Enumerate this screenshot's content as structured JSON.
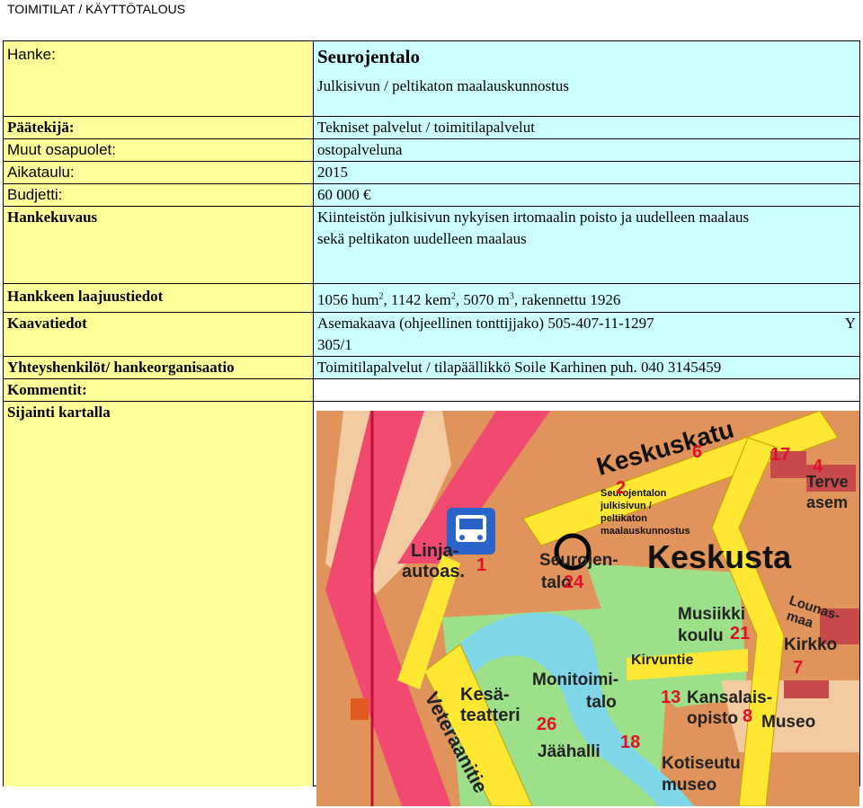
{
  "header": "TOIMITILAT / KÄYTTÖTALOUS",
  "rows": {
    "hanke": {
      "label": "Hanke:",
      "title": "Seurojentalo",
      "subtitle": "Julkisivun / peltikaton maalauskunnostus"
    },
    "paatekija": {
      "label": "Päätekijä:",
      "value": "Tekniset palvelut / toimitilapalvelut"
    },
    "muut": {
      "label": "Muut osapuolet:",
      "value": "ostopalveluna"
    },
    "aikataulu": {
      "label": "Aikataulu:",
      "value": "2015"
    },
    "budjetti": {
      "label": "Budjetti:",
      "value": "60 000 €"
    },
    "hankekuvaus": {
      "label": "Hankekuvaus",
      "value_line1": "Kiinteistön julkisivun nykyisen irtomaalin poisto ja uudelleen maalaus",
      "value_line2": "sekä peltikaton uudelleen maalaus"
    },
    "laajuus": {
      "label": "Hankkeen laajuustiedot",
      "v1": "1056 hum",
      "s1": "2",
      "v2": ", 1142 kem",
      "s2": "2",
      "v3": ", 5070 m",
      "s3": "3",
      "v4": ", rakennettu 1926"
    },
    "kaava": {
      "label": "Kaavatiedot",
      "value": "Asemakaava (ohjeellinen tonttijjako) 505-407-11-1297",
      "value_y": "Y",
      "value_line2": "305/1"
    },
    "yhteys": {
      "label": "Yhteyshenkilöt/ hankeorganisaatio",
      "value": "Toimitilapalvelut / tilapäällikkö Soile Karhinen puh. 040 3145459"
    },
    "kommentit": {
      "label": "Kommentit:"
    },
    "sijainti": {
      "label": "Sijainti kartalla"
    }
  },
  "map": {
    "keskuskatu": "Keskuskatu",
    "keskusta": "Keskusta",
    "marker_line1": "Seurojentalon",
    "marker_line2": "julkisivun /",
    "marker_line3": "peltikaton",
    "marker_line4": "maalauskunnostus",
    "linja1": "Linja-",
    "linja2": "autoas.",
    "seurojen1": "Seurojen-",
    "seurojen2": "talo",
    "musiikki1": "Musiikki",
    "musiikki2": "koulu",
    "kirkko": "Kirkko",
    "kirvuntie": "Kirvuntie",
    "kesa1": "Kesä-",
    "kesa2": "teatteri",
    "monitoimi1": "Monitoimi-",
    "monitoimi2": "talo",
    "kansalais1": "Kansalais-",
    "kansalais2": "opisto",
    "museo": "Museo",
    "jaahalli": "Jäähalli",
    "kotiseutu1": "Kotiseutu",
    "kotiseutu2": "museo",
    "veteraanitie": "Veteraanitie",
    "lounasmaa1": "Lounas-",
    "lounasmaa2": "maa",
    "terve1": "Terve",
    "terve2": "asem",
    "num1": "1",
    "num2": "2",
    "num4": "4",
    "num6": "6",
    "num7": "7",
    "num8": "8",
    "num13": "13",
    "num17": "17",
    "num18": "18",
    "num21": "21",
    "num24": "24",
    "num26": "26"
  }
}
